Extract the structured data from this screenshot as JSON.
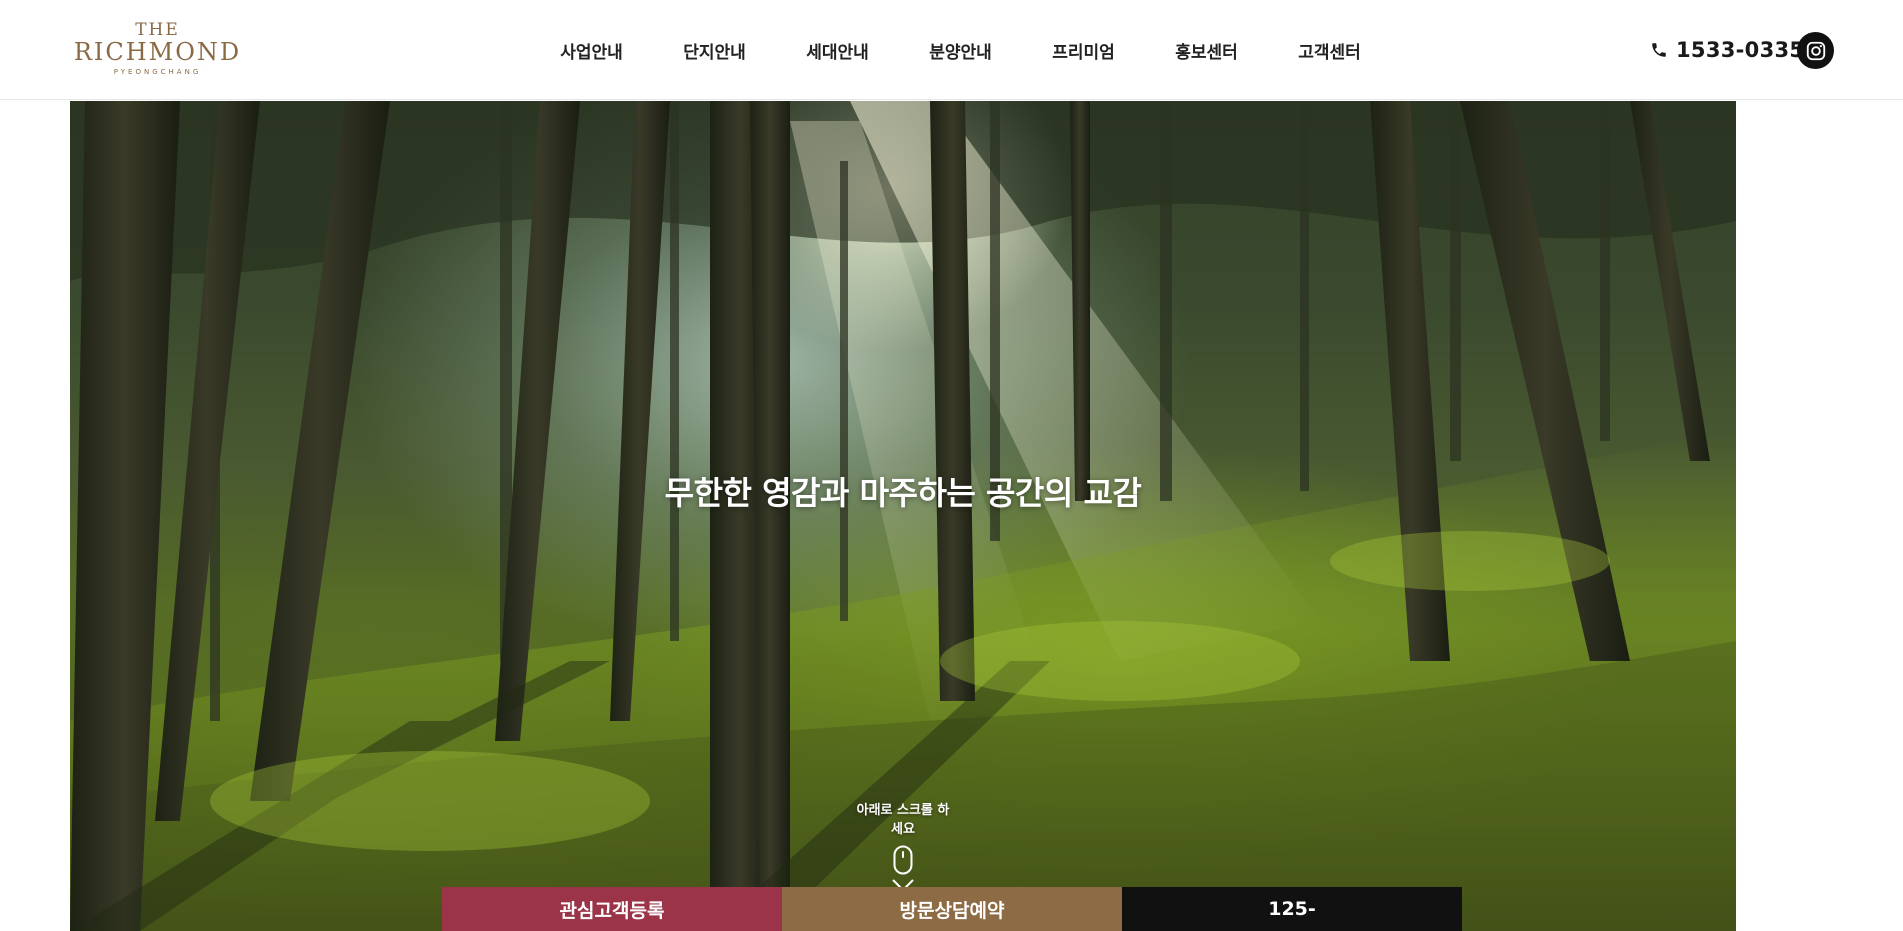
{
  "brand": {
    "the": "THE",
    "name": "RICHMOND",
    "sub": "PYEONGCHANG",
    "color": "#8a6a45"
  },
  "nav": {
    "items": [
      {
        "label": "사업안내"
      },
      {
        "label": "단지안내"
      },
      {
        "label": "세대안내"
      },
      {
        "label": "분양안내"
      },
      {
        "label": "프리미엄"
      },
      {
        "label": "홍보센터"
      },
      {
        "label": "고객센터"
      }
    ]
  },
  "contact": {
    "phone_icon": "phone-icon",
    "phone": "1533-0335",
    "instagram_icon": "instagram-icon"
  },
  "hero": {
    "headline": "무한한 영감과 마주하는 공간의 교감",
    "scroll_text": "아래로 스크롤 하세요",
    "mouse_icon": "mouse-icon",
    "chevron_icon": "chevron-down-icon"
  },
  "cta": {
    "register": "관심고객등록",
    "visit": "방문상담예약",
    "phone": "125-",
    "colors": {
      "register": "#9b3448",
      "visit": "#8c6b45",
      "phone": "#111111"
    }
  }
}
